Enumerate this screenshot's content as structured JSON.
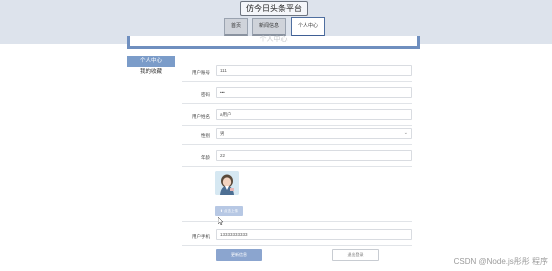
{
  "header": {
    "site_title": "仿今日头条平台",
    "nav": [
      {
        "label": "首页"
      },
      {
        "label": "新闻信息"
      },
      {
        "label": "个人中心"
      }
    ]
  },
  "banner": {
    "title": "个人中心"
  },
  "sidebar": {
    "items": [
      {
        "label": "个人中心",
        "active": true
      },
      {
        "label": "我的收藏",
        "active": false
      }
    ]
  },
  "form": {
    "fields": [
      {
        "label": "用户账号",
        "value": "111"
      },
      {
        "label": "密码",
        "value": "•••"
      },
      {
        "label": "用户姓名",
        "value": "a用户"
      },
      {
        "label": "性别",
        "value": "男"
      },
      {
        "label": "年龄",
        "value": "22"
      }
    ],
    "upload_label": "点击上传",
    "phone": {
      "label": "用户手机",
      "value": "13333333333"
    },
    "update_button": "更新信息",
    "logout_button": "退出登录"
  },
  "watermark": "CSDN @Node.js彤彤 程序",
  "colors": {
    "accent": "#7b9cc9",
    "button": "#8ba5cf"
  }
}
